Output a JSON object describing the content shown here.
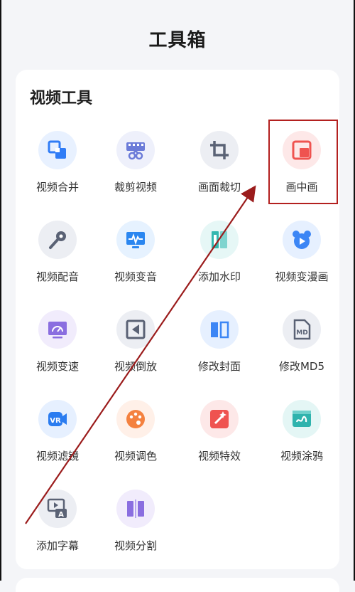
{
  "page": {
    "title": "工具箱"
  },
  "video_tools": {
    "title": "视频工具",
    "items": [
      {
        "label": "视频合并",
        "icon": "merge-icon",
        "bg": "#e8f1ff",
        "color": "#2f7cf6"
      },
      {
        "label": "裁剪视频",
        "icon": "film-scissors-icon",
        "bg": "#eef0fb",
        "color": "#6b7bd8"
      },
      {
        "label": "画面裁切",
        "icon": "crop-icon",
        "bg": "#eceef3",
        "color": "#5a6275"
      },
      {
        "label": "画中画",
        "icon": "picture-in-picture-icon",
        "bg": "#fde8e8",
        "color": "#ef5350"
      },
      {
        "label": "视频配音",
        "icon": "microphone-icon",
        "bg": "#eceef3",
        "color": "#5a6275"
      },
      {
        "label": "视频变音",
        "icon": "waveform-monitor-icon",
        "bg": "#e6f2ff",
        "color": "#2a86f0"
      },
      {
        "label": "添加水印",
        "icon": "stamp-icon",
        "bg": "#e6f7f6",
        "color": "#34b7b0"
      },
      {
        "label": "视频变漫画",
        "icon": "cartoon-bear-icon",
        "bg": "#e6f0ff",
        "color": "#3c86f5"
      },
      {
        "label": "视频变速",
        "icon": "speedometer-icon",
        "bg": "#f1ecfc",
        "color": "#8a6ee0"
      },
      {
        "label": "视频倒放",
        "icon": "rewind-icon",
        "bg": "#eceef3",
        "color": "#5a6275"
      },
      {
        "label": "修改封面",
        "icon": "book-cover-icon",
        "bg": "#e6f0ff",
        "color": "#3c86f5"
      },
      {
        "label": "修改MD5",
        "icon": "md5-file-icon",
        "bg": "#eceef3",
        "color": "#5a6275"
      },
      {
        "label": "视频滤镜",
        "icon": "vr-filter-icon",
        "bg": "#e6f0ff",
        "color": "#2a7cf0"
      },
      {
        "label": "视频调色",
        "icon": "palette-icon",
        "bg": "#fff0e8",
        "color": "#f4813f"
      },
      {
        "label": "视频特效",
        "icon": "sparkle-wand-icon",
        "bg": "#fde8e8",
        "color": "#ef5350"
      },
      {
        "label": "视频涂鸦",
        "icon": "doodle-icon",
        "bg": "#e4f6f5",
        "color": "#2fb3ad"
      },
      {
        "label": "添加字幕",
        "icon": "subtitle-icon",
        "bg": "#eceef3",
        "color": "#5a6275"
      },
      {
        "label": "视频分割",
        "icon": "split-icon",
        "bg": "#f1ecfc",
        "color": "#8a6ee0"
      }
    ]
  },
  "annotation": {
    "highlight_color": "#b3201f",
    "arrow_color": "#9b1c1c"
  }
}
